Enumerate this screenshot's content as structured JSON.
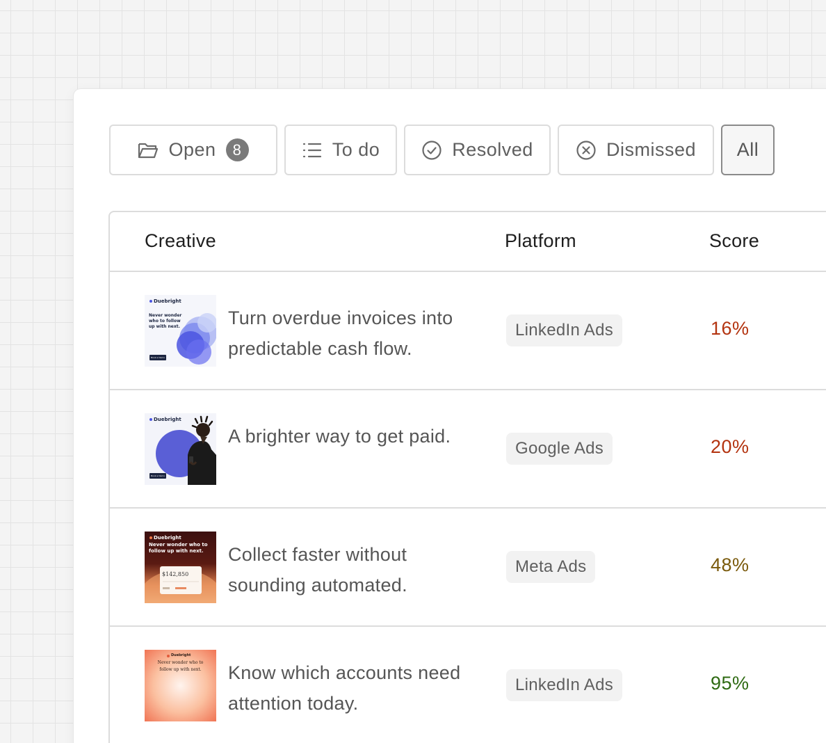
{
  "filters": [
    {
      "label": "Open",
      "count": "8",
      "icon": "folder-icon",
      "active": false
    },
    {
      "label": "To do",
      "icon": "list-icon",
      "active": false
    },
    {
      "label": "Resolved",
      "icon": "check-circle-icon",
      "active": false
    },
    {
      "label": "Dismissed",
      "icon": "x-circle-icon",
      "active": false
    },
    {
      "label": "All",
      "active": true
    }
  ],
  "table": {
    "headers": {
      "creative": "Creative",
      "platform": "Platform",
      "score": "Score"
    },
    "rows": [
      {
        "creative": "Turn overdue invoices into predictable cash flow.",
        "platform": "LinkedIn Ads",
        "score": "16%",
        "score_color": "#b3330f",
        "thumb": {
          "brand": "Duebright",
          "headline": "Never wonder who to follow up with next.",
          "cta": "Book a Demo",
          "style": "blue-discs"
        }
      },
      {
        "creative": "A brighter way to get paid.",
        "platform": "Google Ads",
        "score": "20%",
        "score_color": "#b3330f",
        "thumb": {
          "brand": "Duebright",
          "cta": "Book a Demo",
          "style": "person-purple"
        }
      },
      {
        "creative": "Collect faster without sounding automated.",
        "platform": "Meta Ads",
        "score": "48%",
        "score_color": "#7a5a0c",
        "thumb": {
          "brand": "Duebright",
          "headline": "Never wonder who to follow up with next.",
          "amount": "$142,850",
          "style": "dark-red"
        }
      },
      {
        "creative": "Know which accounts need attention today.",
        "platform": "LinkedIn Ads",
        "score": "95%",
        "score_color": "#2e6a12",
        "thumb": {
          "brand": "Duebright",
          "headline": "Never wonder who to follow up with next.",
          "style": "orange-gradient"
        }
      }
    ]
  }
}
